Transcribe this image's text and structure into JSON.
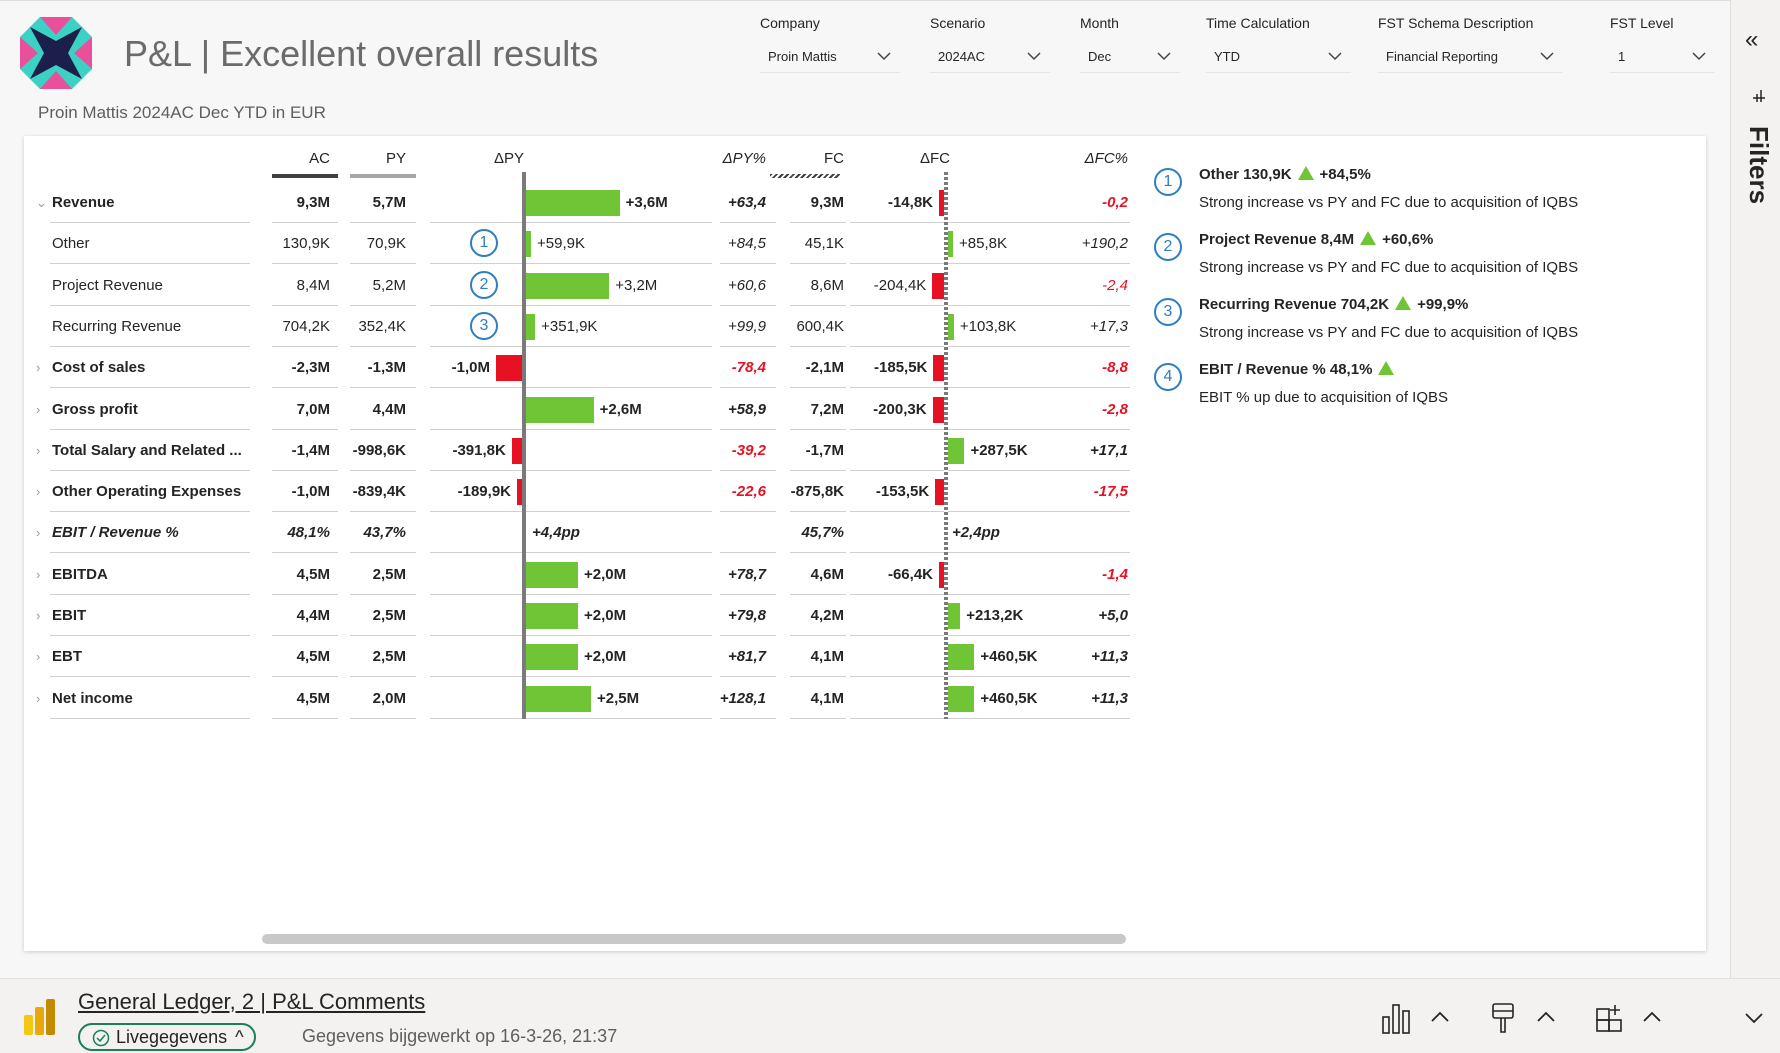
{
  "report": {
    "title": "P&L | Excellent overall results",
    "subtitle": "Proin Mattis 2024AC Dec YTD in EUR"
  },
  "slicers": [
    {
      "label": "Company",
      "value": "Proin Mattis"
    },
    {
      "label": "Scenario",
      "value": "2024AC"
    },
    {
      "label": "Month",
      "value": "Dec"
    },
    {
      "label": "Time Calculation",
      "value": "YTD"
    },
    {
      "label": "FST Schema Description",
      "value": "Financial Reporting"
    },
    {
      "label": "FST Level",
      "value": "1"
    }
  ],
  "table": {
    "headers": {
      "ac": "AC",
      "py": "PY",
      "dpy": "ΔPY",
      "dpy_pct": "ΔPY%",
      "fc": "FC",
      "dfc": "ΔFC",
      "dfc_pct": "ΔFC%"
    },
    "rows": [
      {
        "label": "Revenue",
        "bold": true,
        "italic": false,
        "expand": "⌄",
        "ac": "9,3M",
        "py": "5,7M",
        "dpy": 3.6,
        "dpy_label": "+3,6M",
        "marker": "",
        "dpy_pct": "+63,4",
        "dpy_pct_neg": false,
        "fc": "9,3M",
        "dfc": -0.0148,
        "dfc_label": "-14,8K",
        "dfc_pct": "-0,2",
        "dfc_pct_neg": true
      },
      {
        "label": "Other",
        "bold": false,
        "italic": false,
        "expand": "",
        "ac": "130,9K",
        "py": "70,9K",
        "dpy": 0.0599,
        "dpy_label": "+59,9K",
        "marker": "1",
        "dpy_pct": "+84,5",
        "dpy_pct_neg": false,
        "fc": "45,1K",
        "dfc": 0.0858,
        "dfc_label": "+85,8K",
        "dfc_pct": "+190,2",
        "dfc_pct_neg": false
      },
      {
        "label": "Project Revenue",
        "bold": false,
        "italic": false,
        "expand": "",
        "ac": "8,4M",
        "py": "5,2M",
        "dpy": 3.2,
        "dpy_label": "+3,2M",
        "marker": "2",
        "dpy_pct": "+60,6",
        "dpy_pct_neg": false,
        "fc": "8,6M",
        "dfc": -0.2044,
        "dfc_label": "-204,4K",
        "dfc_pct": "-2,4",
        "dfc_pct_neg": true
      },
      {
        "label": "Recurring Revenue",
        "bold": false,
        "italic": false,
        "expand": "",
        "ac": "704,2K",
        "py": "352,4K",
        "dpy": 0.3519,
        "dpy_label": "+351,9K",
        "marker": "3",
        "dpy_pct": "+99,9",
        "dpy_pct_neg": false,
        "fc": "600,4K",
        "dfc": 0.1038,
        "dfc_label": "+103,8K",
        "dfc_pct": "+17,3",
        "dfc_pct_neg": false
      },
      {
        "label": "Cost of sales",
        "bold": true,
        "italic": false,
        "expand": "›",
        "ac": "-2,3M",
        "py": "-1,3M",
        "dpy": -1.0,
        "dpy_label": "-1,0M",
        "marker": "",
        "dpy_pct": "-78,4",
        "dpy_pct_neg": true,
        "fc": "-2,1M",
        "dfc": -0.1855,
        "dfc_label": "-185,5K",
        "dfc_pct": "-8,8",
        "dfc_pct_neg": true
      },
      {
        "label": "Gross profit",
        "bold": true,
        "italic": false,
        "expand": "›",
        "ac": "7,0M",
        "py": "4,4M",
        "dpy": 2.6,
        "dpy_label": "+2,6M",
        "marker": "",
        "dpy_pct": "+58,9",
        "dpy_pct_neg": false,
        "fc": "7,2M",
        "dfc": -0.2003,
        "dfc_label": "-200,3K",
        "dfc_pct": "-2,8",
        "dfc_pct_neg": true
      },
      {
        "label": "Total Salary and Related ...",
        "bold": true,
        "italic": false,
        "expand": "›",
        "ac": "-1,4M",
        "py": "-998,6K",
        "dpy": -0.3918,
        "dpy_label": "-391,8K",
        "marker": "",
        "dpy_pct": "-39,2",
        "dpy_pct_neg": true,
        "fc": "-1,7M",
        "dfc": 0.2875,
        "dfc_label": "+287,5K",
        "dfc_pct": "+17,1",
        "dfc_pct_neg": false
      },
      {
        "label": "Other Operating Expenses",
        "bold": true,
        "italic": false,
        "expand": "›",
        "ac": "-1,0M",
        "py": "-839,4K",
        "dpy": -0.1899,
        "dpy_label": "-189,9K",
        "marker": "",
        "dpy_pct": "-22,6",
        "dpy_pct_neg": true,
        "fc": "-875,8K",
        "dfc": -0.1535,
        "dfc_label": "-153,5K",
        "dfc_pct": "-17,5",
        "dfc_pct_neg": true
      },
      {
        "label": "EBIT / Revenue %",
        "bold": true,
        "italic": true,
        "expand": "›",
        "ac": "48,1%",
        "py": "43,7%",
        "dpy": 0,
        "dpy_label": "+4,4pp",
        "marker": "",
        "dpy_pct": "",
        "dpy_pct_neg": false,
        "fc": "45,7%",
        "dfc": 0,
        "dfc_label": "+2,4pp",
        "dfc_pct": "",
        "dfc_pct_neg": false
      },
      {
        "label": "EBITDA",
        "bold": true,
        "italic": false,
        "expand": "›",
        "ac": "4,5M",
        "py": "2,5M",
        "dpy": 2.0,
        "dpy_label": "+2,0M",
        "marker": "",
        "dpy_pct": "+78,7",
        "dpy_pct_neg": false,
        "fc": "4,6M",
        "dfc": -0.0664,
        "dfc_label": "-66,4K",
        "dfc_pct": "-1,4",
        "dfc_pct_neg": true
      },
      {
        "label": "EBIT",
        "bold": true,
        "italic": false,
        "expand": "›",
        "ac": "4,4M",
        "py": "2,5M",
        "dpy": 2.0,
        "dpy_label": "+2,0M",
        "marker": "",
        "dpy_pct": "+79,8",
        "dpy_pct_neg": false,
        "fc": "4,2M",
        "dfc": 0.2132,
        "dfc_label": "+213,2K",
        "dfc_pct": "+5,0",
        "dfc_pct_neg": false
      },
      {
        "label": "EBT",
        "bold": true,
        "italic": false,
        "expand": "›",
        "ac": "4,5M",
        "py": "2,5M",
        "dpy": 2.0,
        "dpy_label": "+2,0M",
        "marker": "",
        "dpy_pct": "+81,7",
        "dpy_pct_neg": false,
        "fc": "4,1M",
        "dfc": 0.4605,
        "dfc_label": "+460,5K",
        "dfc_pct": "+11,3",
        "dfc_pct_neg": false
      },
      {
        "label": "Net income",
        "bold": true,
        "italic": false,
        "expand": "›",
        "ac": "4,5M",
        "py": "2,0M",
        "dpy": 2.5,
        "dpy_label": "+2,5M",
        "marker": "",
        "dpy_pct": "+128,1",
        "dpy_pct_neg": false,
        "fc": "4,1M",
        "dfc": 0.4605,
        "dfc_label": "+460,5K",
        "dfc_pct": "+11,3",
        "dfc_pct_neg": false
      }
    ]
  },
  "comments": [
    {
      "num": "1",
      "title": "Other 130,9K",
      "delta": "+84,5%",
      "body": "Strong increase vs PY and FC due to acquisition of IQBS"
    },
    {
      "num": "2",
      "title": "Project Revenue 8,4M",
      "delta": "+60,6%",
      "body": "Strong increase vs PY and FC due to acquisition of IQBS"
    },
    {
      "num": "3",
      "title": "Recurring Revenue 704,2K",
      "delta": "+99,9%",
      "body": "Strong increase vs PY and FC due to acquisition of IQBS"
    },
    {
      "num": "4",
      "title": "EBIT / Revenue % 48,1%",
      "delta": "",
      "body": "EBIT % up due to acquisition of IQBS"
    }
  ],
  "right_pane": {
    "label": "Filters",
    "collapse_glyph": "«"
  },
  "footer": {
    "title": "General Ledger, 2 | P&L Comments",
    "live_label": "Livegegevens",
    "updated": "Gegevens bijgewerkt op 16-3-26, 21:37"
  },
  "colors": {
    "positive": "#70c537",
    "negative": "#e81123",
    "marker": "#2e7ec1"
  }
}
